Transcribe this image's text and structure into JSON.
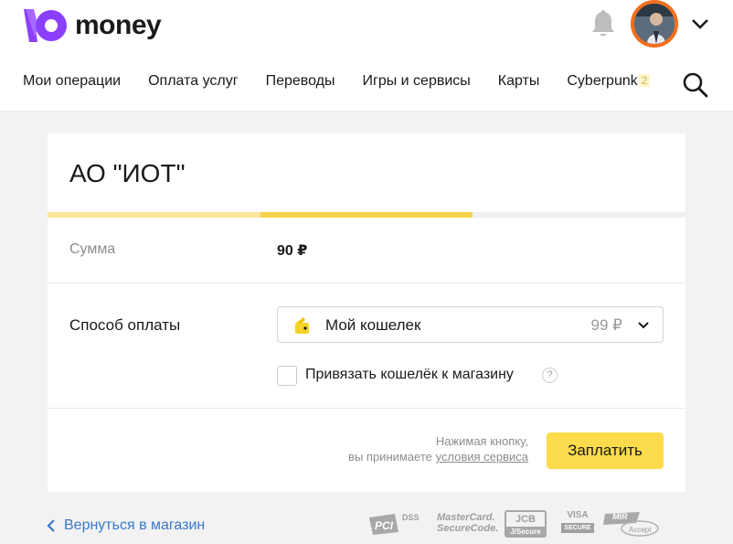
{
  "brand": {
    "name": "money"
  },
  "nav": {
    "items": [
      "Мои операции",
      "Оплата услуг",
      "Переводы",
      "Игры и сервисы",
      "Карты",
      "Cyberpunk"
    ],
    "badge": "2"
  },
  "payment": {
    "merchant": "АО \"ИОТ\"",
    "progress_fraction": 0.67,
    "sum_label": "Сумма",
    "sum_value": "90 ₽",
    "method_label": "Способ оплаты",
    "method_name": "Мой кошелек",
    "method_balance": "99 ₽",
    "link_checkbox_label": "Привязать кошелёк к магазину",
    "link_checkbox_checked": false,
    "help_symbol": "?",
    "terms_line1": "Нажимая кнопку,",
    "terms_line2_prefix": "вы принимаете ",
    "terms_link": "условия сервиса",
    "pay_button": "Заплатить"
  },
  "footer": {
    "back_link": "Вернуться в магазин",
    "security_logos": {
      "pci": "DSS",
      "mastercard_line1": "MasterCard.",
      "mastercard_line2": "SecureCode.",
      "jcb_line1": "JCB",
      "jcb_line2": "J/Secure",
      "visa_line1": "VISA",
      "visa_line2": "SECURE",
      "mir_line1": "MIR",
      "mir_line2": "Accept"
    }
  },
  "colors": {
    "accent_yellow": "#fcdc4d",
    "brand_purple": "#8b3ffd",
    "link_blue": "#3a78c9",
    "avatar_ring": "#f26f21"
  }
}
